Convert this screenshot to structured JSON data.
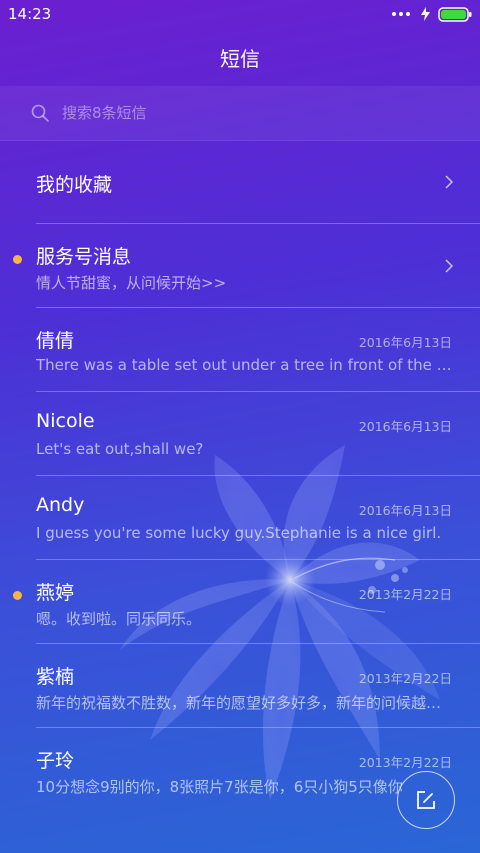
{
  "status_bar": {
    "time": "14:23",
    "icons": [
      "dots-icon",
      "charging-bolt-icon",
      "battery-icon"
    ],
    "battery_color": "#3ddc3a"
  },
  "header": {
    "title": "短信"
  },
  "search": {
    "placeholder": "搜索8条短信"
  },
  "items": [
    {
      "name": "我的收藏",
      "preview": "",
      "date": "",
      "unread": false,
      "chevron": true
    },
    {
      "name": "服务号消息",
      "preview": "情人节甜蜜，从问候开始>>",
      "date": "",
      "unread": true,
      "chevron": true
    },
    {
      "name": "倩倩",
      "preview": "There was a table set out under a tree in front of the house",
      "date": "2016年6月13日",
      "unread": false,
      "chevron": false
    },
    {
      "name": "Nicole",
      "preview": "Let's eat out,shall we?",
      "date": "2016年6月13日",
      "unread": false,
      "chevron": false
    },
    {
      "name": "Andy",
      "preview": "I guess you're some lucky guy.Stephanie is a nice girl.",
      "date": "2016年6月13日",
      "unread": false,
      "chevron": false
    },
    {
      "name": "燕婷",
      "preview": "嗯。收到啦。同乐同乐。",
      "date": "2013年2月22日",
      "unread": true,
      "chevron": false
    },
    {
      "name": "紫楠",
      "preview": "新年的祝福数不胜数，新年的愿望好多好多，新年的问候越来越多",
      "date": "2013年2月22日",
      "unread": false,
      "chevron": false
    },
    {
      "name": "子玲",
      "preview": "10分想念9别的你，8张照片7张是你，6只小狗5只像你",
      "date": "2013年2月22日",
      "unread": false,
      "chevron": false
    }
  ],
  "compose_button": {
    "icon": "compose-icon"
  },
  "colors": {
    "unread_dot": "#f7b548",
    "background_top": "#6c1fd0",
    "background_bottom": "#2a66d6"
  }
}
